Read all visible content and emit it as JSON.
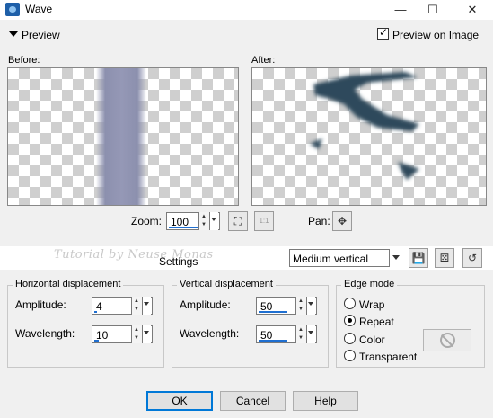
{
  "window": {
    "title": "Wave",
    "minimize_glyph": "—",
    "maximize_glyph": "☐",
    "close_glyph": "✕"
  },
  "preview": {
    "toggle_label": "Preview",
    "preview_on_image_label": "Preview on Image",
    "preview_on_image_checked": true,
    "before_label": "Before:",
    "after_label": "After:"
  },
  "zoom": {
    "label": "Zoom:",
    "value": "100",
    "actual_size_icon": "1:1",
    "pan_label": "Pan:"
  },
  "settings": {
    "label": "Settings",
    "watermark": "Tutorial by Neuse Monas",
    "preset_value": "Medium vertical"
  },
  "horizontal": {
    "title": "Horizontal displacement",
    "amplitude_label": "Amplitude:",
    "amplitude_value": "4",
    "wavelength_label": "Wavelength:",
    "wavelength_value": "10"
  },
  "vertical": {
    "title": "Vertical displacement",
    "amplitude_label": "Amplitude:",
    "amplitude_value": "50",
    "wavelength_label": "Wavelength:",
    "wavelength_value": "50"
  },
  "edge_mode": {
    "title": "Edge mode",
    "options": [
      "Wrap",
      "Repeat",
      "Color",
      "Transparent"
    ],
    "selected": "Repeat"
  },
  "buttons": {
    "ok": "OK",
    "cancel": "Cancel",
    "help": "Help"
  },
  "colors": {
    "accent": "#0078d7",
    "stripe": "#8a8eac",
    "wave": "#2d4a5c"
  }
}
